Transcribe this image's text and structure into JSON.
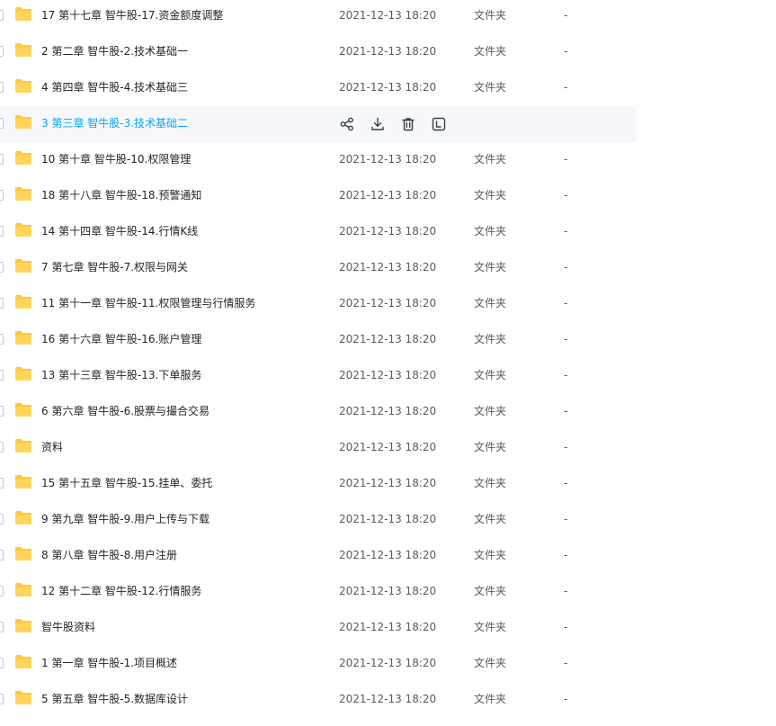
{
  "list": {
    "hovered_index": 3,
    "actions": {
      "share": "share-icon",
      "download": "download-icon",
      "delete": "trash-icon",
      "more": "text-box-icon"
    },
    "colors": {
      "folder": "#ffc940",
      "hover_text": "#06a7ff",
      "hover_bg": "#f6f8fb"
    },
    "rows": [
      {
        "name": "17 第十七章 智牛股-17.资金额度调整",
        "date": "2021-12-13 18:20",
        "type": "文件夹",
        "size": "-"
      },
      {
        "name": "2 第二章 智牛股-2.技术基础一",
        "date": "2021-12-13 18:20",
        "type": "文件夹",
        "size": "-"
      },
      {
        "name": "4 第四章 智牛股-4.技术基础三",
        "date": "2021-12-13 18:20",
        "type": "文件夹",
        "size": "-"
      },
      {
        "name": "3 第三章 智牛股-3.技术基础二",
        "date": "",
        "type": "",
        "size": ""
      },
      {
        "name": "10 第十章 智牛股-10.权限管理",
        "date": "2021-12-13 18:20",
        "type": "文件夹",
        "size": "-"
      },
      {
        "name": "18 第十八章 智牛股-18.预警通知",
        "date": "2021-12-13 18:20",
        "type": "文件夹",
        "size": "-"
      },
      {
        "name": "14 第十四章 智牛股-14.行情K线",
        "date": "2021-12-13 18:20",
        "type": "文件夹",
        "size": "-"
      },
      {
        "name": "7 第七章 智牛股-7.权限与网关",
        "date": "2021-12-13 18:20",
        "type": "文件夹",
        "size": "-"
      },
      {
        "name": "11 第十一章 智牛股-11.权限管理与行情服务",
        "date": "2021-12-13 18:20",
        "type": "文件夹",
        "size": "-"
      },
      {
        "name": "16 第十六章 智牛股-16.账户管理",
        "date": "2021-12-13 18:20",
        "type": "文件夹",
        "size": "-"
      },
      {
        "name": "13 第十三章 智牛股-13.下单服务",
        "date": "2021-12-13 18:20",
        "type": "文件夹",
        "size": "-"
      },
      {
        "name": "6 第六章 智牛股-6.股票与撮合交易",
        "date": "2021-12-13 18:20",
        "type": "文件夹",
        "size": "-"
      },
      {
        "name": "资料",
        "date": "2021-12-13 18:20",
        "type": "文件夹",
        "size": "-"
      },
      {
        "name": "15 第十五章 智牛股-15.挂单、委托",
        "date": "2021-12-13 18:20",
        "type": "文件夹",
        "size": "-"
      },
      {
        "name": "9 第九章 智牛股-9.用户上传与下载",
        "date": "2021-12-13 18:20",
        "type": "文件夹",
        "size": "-"
      },
      {
        "name": "8 第八章 智牛股-8.用户注册",
        "date": "2021-12-13 18:20",
        "type": "文件夹",
        "size": "-"
      },
      {
        "name": "12 第十二章 智牛股-12.行情服务",
        "date": "2021-12-13 18:20",
        "type": "文件夹",
        "size": "-"
      },
      {
        "name": "智牛股资料",
        "date": "2021-12-13 18:20",
        "type": "文件夹",
        "size": "-"
      },
      {
        "name": "1 第一章 智牛股-1.项目概述",
        "date": "2021-12-13 18:20",
        "type": "文件夹",
        "size": "-"
      },
      {
        "name": "5 第五章 智牛股-5.数据库设计",
        "date": "2021-12-13 18:20",
        "type": "文件夹",
        "size": "-"
      }
    ]
  }
}
